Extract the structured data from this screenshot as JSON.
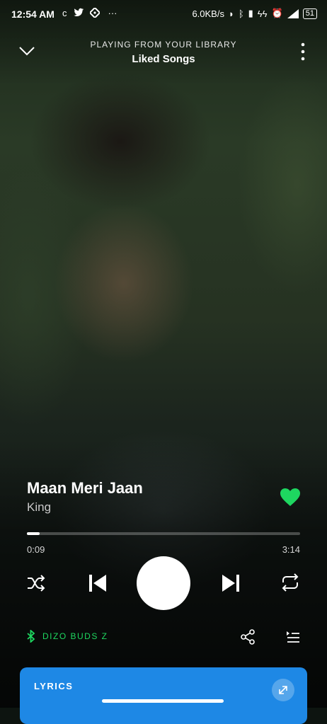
{
  "status_bar": {
    "time": "12:54 AM",
    "left_icons": [
      "c-icon",
      "twitter-icon",
      "navigation-icon",
      "more-dots-icon"
    ],
    "network_speed": "6.0KB/s",
    "battery": "51"
  },
  "header": {
    "playing_from": "PLAYING FROM YOUR LIBRARY",
    "source": "Liked Songs"
  },
  "track": {
    "title": "Maan Meri Jaan",
    "artist": "King",
    "liked": true
  },
  "progress": {
    "elapsed": "0:09",
    "total": "3:14",
    "fraction": 0.046
  },
  "device": {
    "name": "DIZO BUDS Z"
  },
  "lyrics": {
    "label": "LYRICS"
  },
  "colors": {
    "accent": "#1ed760",
    "lyrics_card": "#1e88e5"
  }
}
